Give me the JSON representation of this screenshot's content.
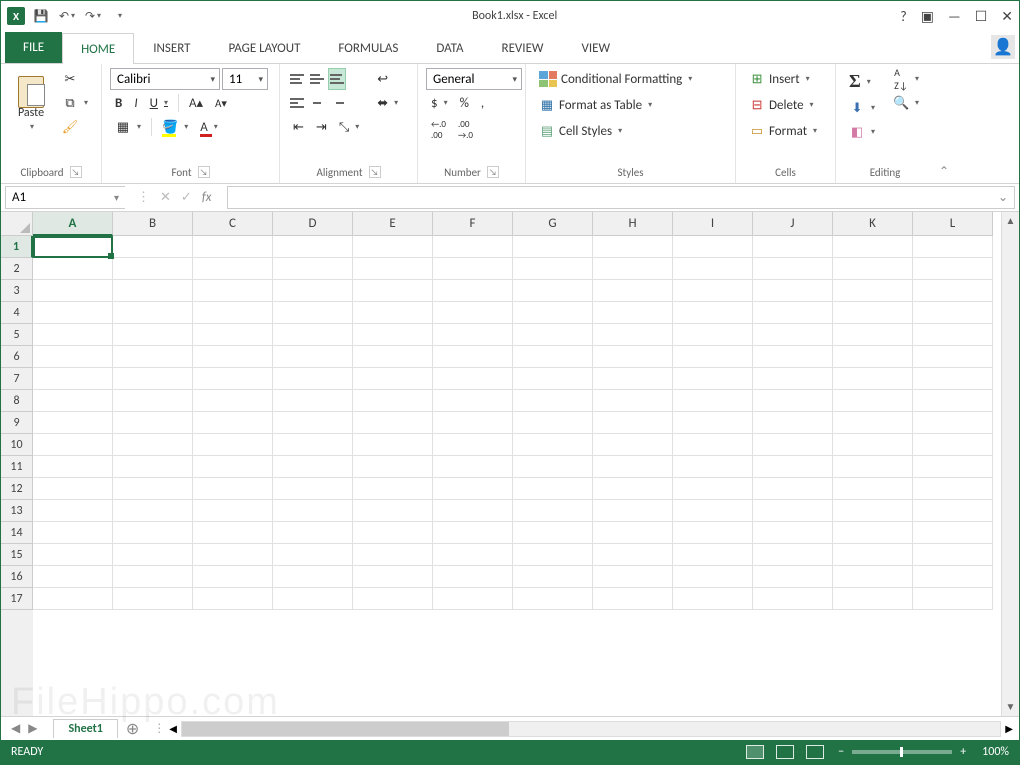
{
  "title": "Book1.xlsx - Excel",
  "qat": {
    "logo": "X"
  },
  "tabs": {
    "file": "FILE",
    "items": [
      "HOME",
      "INSERT",
      "PAGE LAYOUT",
      "FORMULAS",
      "DATA",
      "REVIEW",
      "VIEW"
    ],
    "active": "HOME"
  },
  "ribbon": {
    "clipboard": {
      "label": "Clipboard",
      "paste": "Paste"
    },
    "font": {
      "label": "Font",
      "name": "Calibri",
      "size": "11",
      "bold": "B",
      "italic": "I",
      "underline": "U"
    },
    "alignment": {
      "label": "Alignment"
    },
    "number": {
      "label": "Number",
      "format": "General",
      "percent": "%",
      "comma": ",",
      "currency": "$",
      "inc": ".0 .00",
      "dec": ".00 .0"
    },
    "styles": {
      "label": "Styles",
      "cond": "Conditional Formatting",
      "table": "Format as Table",
      "cell": "Cell Styles"
    },
    "cells": {
      "label": "Cells",
      "insert": "Insert",
      "delete": "Delete",
      "format": "Format"
    },
    "editing": {
      "label": "Editing"
    }
  },
  "fbar": {
    "name": "A1",
    "fx": "fx"
  },
  "grid": {
    "columns": [
      "A",
      "B",
      "C",
      "D",
      "E",
      "F",
      "G",
      "H",
      "I",
      "J",
      "K",
      "L"
    ],
    "rows": [
      1,
      2,
      3,
      4,
      5,
      6,
      7,
      8,
      9,
      10,
      11,
      12,
      13,
      14,
      15,
      16,
      17
    ],
    "active_col": "A",
    "active_row": 1
  },
  "sheet": {
    "name": "Sheet1",
    "add": "⊕"
  },
  "status": {
    "ready": "READY",
    "zoom": "100%"
  },
  "watermark": "FileHippo.com"
}
